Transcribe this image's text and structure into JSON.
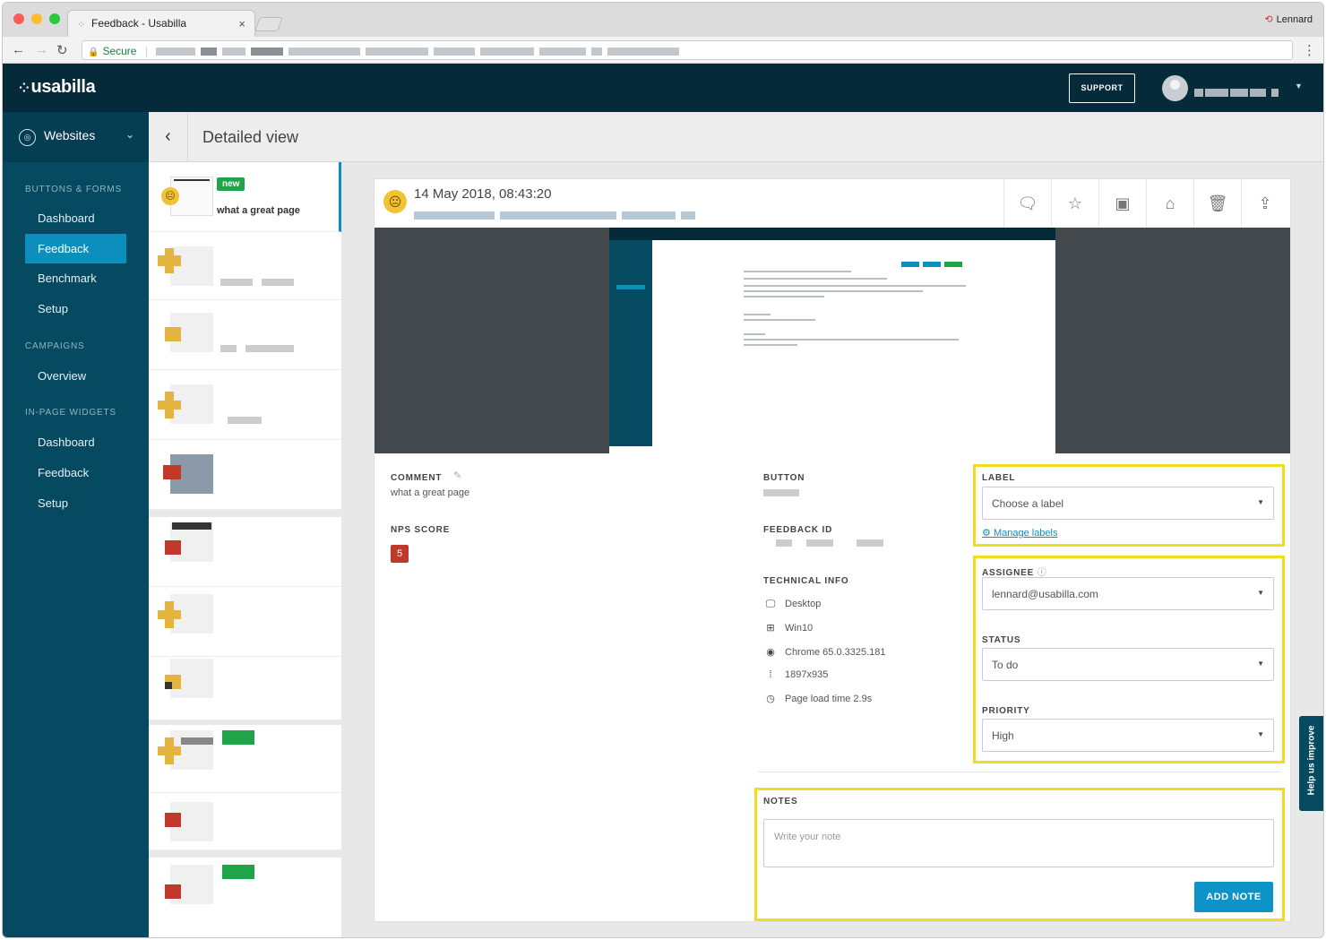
{
  "browser": {
    "tab_title": "Feedback - Usabilla",
    "tab_close": "×",
    "profile_name": "Lennard",
    "secure_label": "Secure"
  },
  "header": {
    "logo": "usabilla",
    "support_label": "SUPPORT"
  },
  "sidebar": {
    "selector_label": "Websites",
    "sections": [
      {
        "title": "BUTTONS & FORMS",
        "items": [
          "Dashboard",
          "Feedback",
          "Benchmark",
          "Setup"
        ]
      },
      {
        "title": "CAMPAIGNS",
        "items": [
          "Overview"
        ]
      },
      {
        "title": "IN-PAGE WIDGETS",
        "items": [
          "Dashboard",
          "Feedback",
          "Setup"
        ]
      }
    ],
    "active_item": "Feedback"
  },
  "page": {
    "title": "Detailed view"
  },
  "feedback_list": {
    "first_item": {
      "badge": "new",
      "comment": "what a great page"
    }
  },
  "detail": {
    "date": "14 May 2018, 08:43:20",
    "comment_label": "COMMENT",
    "comment": "what a great page",
    "nps_label": "NPS SCORE",
    "nps_value": "5",
    "button_label": "BUTTON",
    "feedback_id_label": "FEEDBACK ID",
    "tech_label": "TECHNICAL INFO",
    "tech": {
      "device": "Desktop",
      "os": "Win10",
      "browser": "Chrome 65.0.3325.181",
      "resolution": "1897x935",
      "load_time": "Page load time 2.9s"
    },
    "label_label": "LABEL",
    "label_value": "Choose a label",
    "manage_labels": "Manage labels",
    "assignee_label": "ASSIGNEE",
    "assignee_value": "lennard@usabilla.com",
    "status_label": "STATUS",
    "status_value": "To do",
    "priority_label": "PRIORITY",
    "priority_value": "High",
    "notes_label": "NOTES",
    "notes_placeholder": "Write your note",
    "add_note": "ADD NOTE"
  },
  "help_tab": "Help us improve",
  "colors": {
    "header_bg": "#052b3a",
    "sidebar_bg": "#064a62",
    "accent": "#0d8fbd",
    "highlight": "#f0dd1f",
    "nps_red": "#c0392b",
    "new_green": "#21a34a"
  },
  "icons": [
    "back-arrow-icon",
    "reload-icon",
    "lock-icon",
    "globe-icon",
    "chevron-down-icon",
    "chevron-left-icon",
    "comment-icon",
    "star-icon",
    "screenshot-icon",
    "inbox-icon",
    "trash-icon",
    "share-icon",
    "desktop-icon",
    "windows-icon",
    "chrome-icon",
    "resolution-icon",
    "clock-icon",
    "gear-icon",
    "info-icon",
    "edit-icon"
  ]
}
